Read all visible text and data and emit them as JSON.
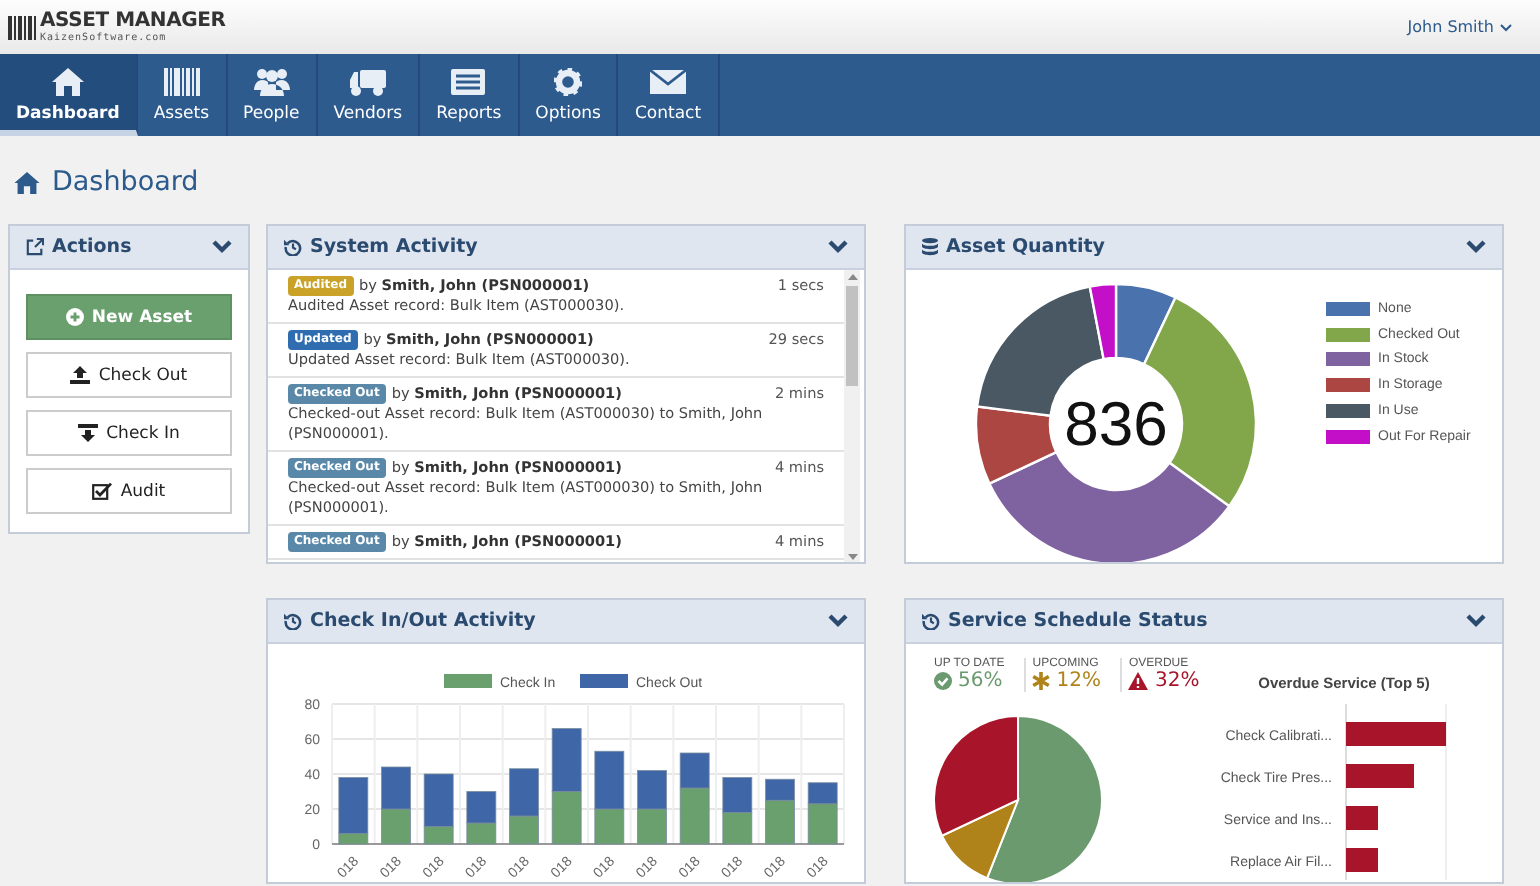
{
  "header": {
    "logo_title": "ASSET MANAGER",
    "logo_subtitle": "KaizenSoftware.com",
    "user": "John Smith"
  },
  "nav": {
    "items": [
      {
        "label": "Dashboard",
        "selected": true
      },
      {
        "label": "Assets",
        "selected": false
      },
      {
        "label": "People",
        "selected": false
      },
      {
        "label": "Vendors",
        "selected": false
      },
      {
        "label": "Reports",
        "selected": false
      },
      {
        "label": "Options",
        "selected": false
      },
      {
        "label": "Contact",
        "selected": false
      }
    ]
  },
  "page_title": "Dashboard",
  "actions": {
    "title": "Actions",
    "buttons": [
      {
        "label": "New Asset",
        "kind": "primary"
      },
      {
        "label": "Check Out",
        "kind": "default"
      },
      {
        "label": "Check In",
        "kind": "default"
      },
      {
        "label": "Audit",
        "kind": "default"
      }
    ]
  },
  "system_activity": {
    "title": "System Activity",
    "items": [
      {
        "badge": "Audited",
        "color": "#c9a227",
        "author": "by **Smith, John (PSN000001)**",
        "time": "1 secs",
        "description": "Audited Asset record: Bulk Item (AST000030)."
      },
      {
        "badge": "Updated",
        "color": "#2f6db0",
        "author": "by **Smith, John (PSN000001)**",
        "time": "29 secs",
        "description": "Updated Asset record: Bulk Item (AST000030)."
      },
      {
        "badge": "Checked Out",
        "color": "#5a88a8",
        "author": "by **Smith, John (PSN000001)**",
        "time": "2 mins",
        "description": "Checked-out Asset record: Bulk Item (AST000030) to Smith, John (PSN000001)."
      },
      {
        "badge": "Checked Out",
        "color": "#5a88a8",
        "author": "by **Smith, John (PSN000001)**",
        "time": "4 mins",
        "description": "Checked-out Asset record: Bulk Item (AST000030) to Smith, John (PSN000001)."
      },
      {
        "badge": "Checked Out",
        "color": "#5a88a8",
        "author": "by **Smith, John (PSN000001)**",
        "time": "4 mins"
      }
    ]
  },
  "asset_quantity": {
    "title": "Asset Quantity",
    "total": "836",
    "legend": [
      {
        "label": "None",
        "color": "#4a72ad"
      },
      {
        "label": "Checked Out",
        "color": "#82a64a"
      },
      {
        "label": "In Stock",
        "color": "#7f62a0"
      },
      {
        "label": "In Storage",
        "color": "#ab4642"
      },
      {
        "label": "In Use",
        "color": "#4a5863"
      },
      {
        "label": "Out For Repair",
        "color": "#c40fc9"
      }
    ]
  },
  "check_activity": {
    "title": "Check In/Out Activity",
    "chart_data": {
      "type": "bar",
      "stacked": true,
      "grid": true,
      "legend": "top",
      "categories": [
        "018",
        "018",
        "018",
        "018",
        "018",
        "018",
        "018",
        "018",
        "018",
        "018",
        "018",
        "018"
      ],
      "ylim": [
        0,
        80
      ],
      "yticks": [
        0,
        20,
        40,
        60,
        80
      ],
      "series": [
        {
          "name": "Check In",
          "color": "#6a9f6e",
          "values": [
            6,
            20,
            10,
            12,
            16,
            30,
            20,
            20,
            32,
            18,
            25,
            23
          ]
        },
        {
          "name": "Check Out",
          "color": "#3f66a6",
          "values": [
            32,
            24,
            30,
            18,
            27,
            36,
            33,
            22,
            20,
            20,
            12,
            12
          ]
        }
      ]
    }
  },
  "service_schedule": {
    "title": "Service Schedule Status",
    "stats": [
      {
        "label": "UP TO DATE",
        "value": "56%",
        "color": "#6a9a6e"
      },
      {
        "label": "UPCOMING",
        "value": "12%",
        "color": "#b0821a"
      },
      {
        "label": "OVERDUE",
        "value": "32%",
        "color": "#a8142a"
      }
    ],
    "chart_data": {
      "type": "pie",
      "values": [
        56,
        12,
        32
      ]
    },
    "overdue_chart": {
      "title": "Overdue Service (Top 5)",
      "labels": [
        "Check Calibrati...",
        "Check Tire Pres...",
        "Service and Ins...",
        "Replace Air Fil..."
      ]
    }
  }
}
